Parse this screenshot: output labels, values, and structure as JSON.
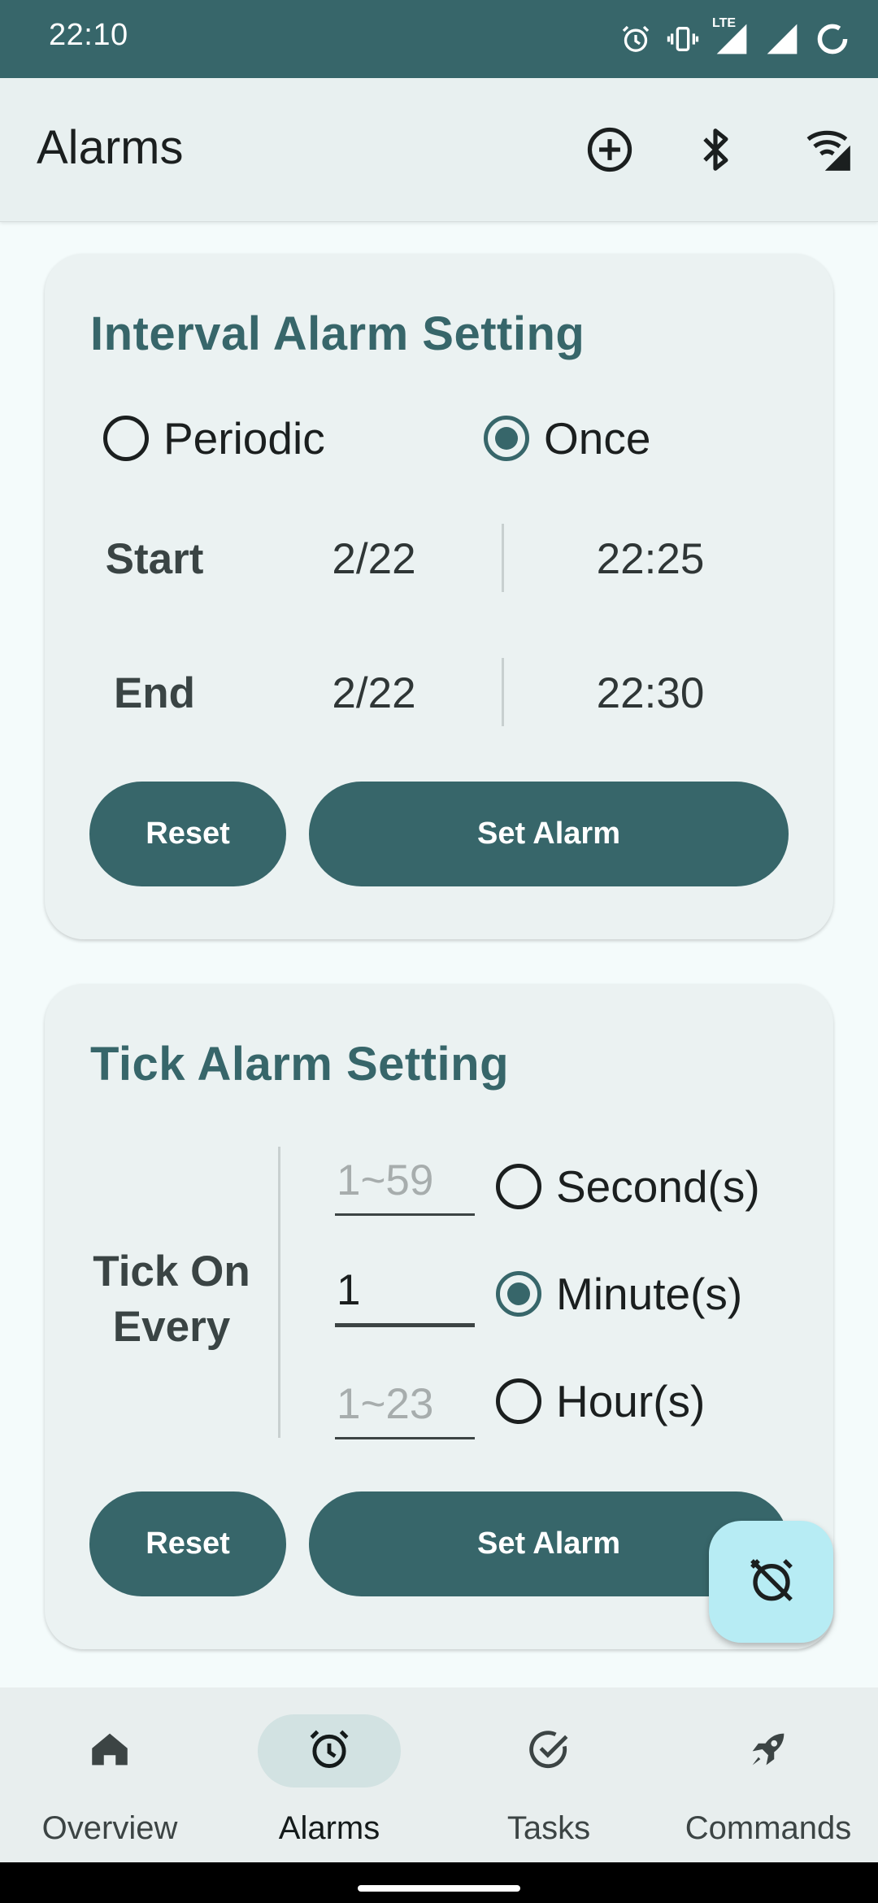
{
  "status_bar": {
    "time": "22:10",
    "network_label": "LTE"
  },
  "app_bar": {
    "title": "Alarms",
    "actions": [
      "add-circle-icon",
      "bluetooth-icon",
      "wifi-signal-icon"
    ]
  },
  "interval_card": {
    "title": "Interval Alarm Setting",
    "mode_options": [
      {
        "label": "Periodic",
        "selected": false
      },
      {
        "label": "Once",
        "selected": true
      }
    ],
    "start": {
      "label": "Start",
      "date": "2/22",
      "time": "22:25"
    },
    "end": {
      "label": "End",
      "date": "2/22",
      "time": "22:30"
    },
    "reset_label": "Reset",
    "set_label": "Set Alarm"
  },
  "tick_card": {
    "title": "Tick Alarm Setting",
    "tick_label_line1": "Tick On",
    "tick_label_line2": "Every",
    "fields": {
      "seconds_placeholder": "1~59",
      "minutes_value": "1",
      "hours_placeholder": "1~23"
    },
    "units": [
      {
        "label": "Second(s)",
        "selected": false
      },
      {
        "label": "Minute(s)",
        "selected": true
      },
      {
        "label": "Hour(s)",
        "selected": false
      }
    ],
    "reset_label": "Reset",
    "set_label": "Set Alarm"
  },
  "fab": {
    "icon": "alarm-off-icon"
  },
  "bottom_nav": {
    "items": [
      {
        "label": "Overview",
        "icon": "home-icon",
        "selected": false
      },
      {
        "label": "Alarms",
        "icon": "alarm-icon",
        "selected": true
      },
      {
        "label": "Tasks",
        "icon": "check-circle-icon",
        "selected": false
      },
      {
        "label": "Commands",
        "icon": "rocket-icon",
        "selected": false
      }
    ]
  },
  "colors": {
    "primary": "#37666a",
    "surface": "#ebf2f2",
    "fab": "#b7ecf4",
    "background": "#f4fbfb"
  }
}
